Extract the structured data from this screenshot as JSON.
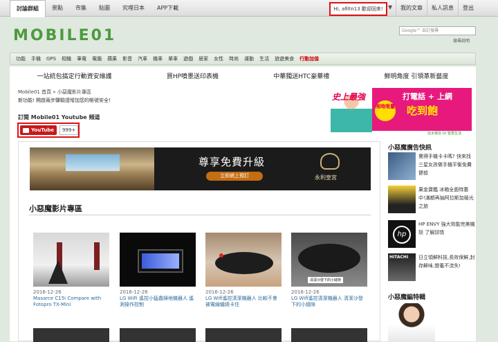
{
  "topnav": {
    "items": [
      "討論群組",
      "景點",
      "市集",
      "貼圖",
      "究哩日本",
      "APP下載"
    ]
  },
  "user": {
    "greeting": "Hi, afiltn13 歡迎回來!",
    "links": [
      "我的文章",
      "私人訊息",
      "登出"
    ]
  },
  "logo": {
    "text": "MOBILE01"
  },
  "search": {
    "placeholder": "Google™ 自訂搜尋",
    "hint": "搜尋說明"
  },
  "categories": [
    "功能",
    "手機",
    "GPS",
    "相機",
    "筆電",
    "電腦",
    "蘋果",
    "影音",
    "汽車",
    "機車",
    "單車",
    "遊戲",
    "居家",
    "女性",
    "時尚",
    "運動",
    "生活",
    "旅遊美食",
    "行動加值"
  ],
  "promos": [
    "一站統包搞定行動資安維護",
    "買HP噴墨送印表機",
    "中華獨送HTC豪華禮",
    "鮮明角度 引領革新藝度"
  ],
  "breadcrumb": "Mobile01 首頁 » 小惡魔影片專區",
  "notice": "新功能! 開啟兩步驟驗證增加您的帳號安全!",
  "subscribe": {
    "title": "訂閱 Mobile01 Youtube 頻道",
    "button": "YouTube",
    "count": "999+"
  },
  "topad": {
    "slogan": "史上最強",
    "line1": "打電話 + 上網",
    "line2": "吃到飽",
    "tag": "限時限量",
    "footer": "亞太電信 Gt 智慧生活"
  },
  "banner": {
    "headline": "尊享免費升級",
    "cta": "立即網上預訂",
    "brand": "永利皇宮"
  },
  "section": {
    "title": "小惡魔影片專區"
  },
  "videos": [
    {
      "date": "2016-12-26",
      "title": "Masarce C15i Compare with Fotopro TX-Mini"
    },
    {
      "date": "2016-12-26",
      "title": "LG WiFi 遙控小猛蟲掃地機器人 遙測操作控制"
    },
    {
      "date": "2016-12-26",
      "title": "LG Wifi遙控清潔機器人 比較不會被電線纏繞卡住"
    },
    {
      "date": "2016-12-26",
      "title": "LG Wifi遙控清潔機器人 清潔沙發下的小縫隙"
    }
  ],
  "video4_label": "清潔沙發下的小縫隙",
  "sidebar": {
    "header1": "小惡魔廣告快訊",
    "items": [
      {
        "text": "覺得手機卡卡嗎? 快來找三星女孩做手機平衡免費健檢"
      },
      {
        "text": "果金寶鑑 冰箱全面特惠中!滿額再抽阿拉斯加極光之旅"
      },
      {
        "text": "HP ENVY 強大效能完美機殼 了解詳情"
      },
      {
        "text": "日立領鮮料技,長效保鮮,封存鮮味,營養不流失!"
      }
    ],
    "header2": "小惡魔編特輯"
  }
}
